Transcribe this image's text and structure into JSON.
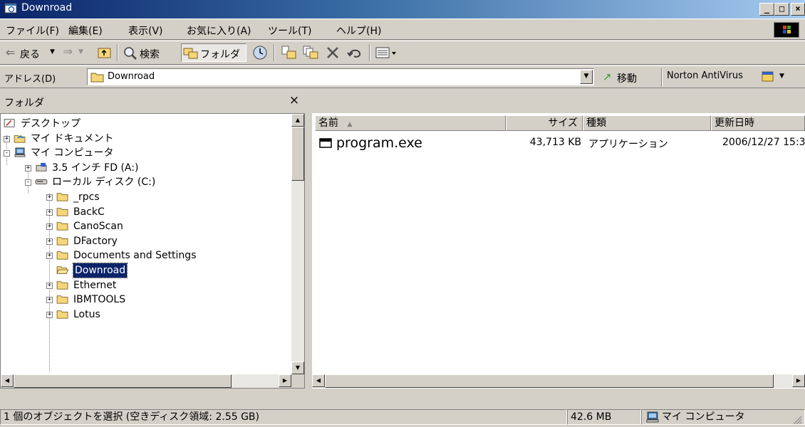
{
  "window": {
    "title": "Downroad"
  },
  "menu": [
    "ファイル(F)",
    "編集(E)",
    "表示(V)",
    "お気に入り(A)",
    "ツール(T)",
    "ヘルプ(H)"
  ],
  "toolbar": {
    "back_label": "戻る",
    "search_label": "検索",
    "folders_label": "フォルダ"
  },
  "address": {
    "label": "アドレス(D)",
    "value": "Downroad",
    "go_label": "移動",
    "norton_label": "Norton AntiVirus"
  },
  "folder_pane": {
    "title": "フォルダ",
    "close_glyph": "×",
    "items": [
      {
        "label": "デスクトップ",
        "expander": ""
      },
      {
        "label": "マイ ドキュメント",
        "expander": "+"
      },
      {
        "label": "マイ コンピュータ",
        "expander": "−"
      },
      {
        "label": "3.5 インチ FD (A:)",
        "expander": "+"
      },
      {
        "label": "ローカル ディスク (C:)",
        "expander": "−"
      },
      {
        "label": "_rpcs",
        "expander": "+"
      },
      {
        "label": "BackC",
        "expander": "+"
      },
      {
        "label": "CanoScan",
        "expander": "+"
      },
      {
        "label": "DFactory",
        "expander": "+"
      },
      {
        "label": "Documents and Settings",
        "expander": "+"
      },
      {
        "label": "Downroad",
        "expander": "",
        "selected": true
      },
      {
        "label": "Ethernet",
        "expander": "+"
      },
      {
        "label": "IBMTOOLS",
        "expander": "+"
      },
      {
        "label": "Lotus",
        "expander": "+"
      }
    ]
  },
  "list": {
    "columns": {
      "name": "名前",
      "size": "サイズ",
      "type": "種類",
      "modified": "更新日時"
    },
    "rows": [
      {
        "name": "program.exe",
        "size": "43,713 KB",
        "type": "アプリケーション",
        "modified": "2006/12/27 15:3"
      }
    ]
  },
  "status": {
    "selection": "1 個のオブジェクトを選択 (空きディスク領域: 2.55 GB)",
    "size": "42.6 MB",
    "location": "マイ コンピュータ"
  },
  "colors": {
    "title_start": "#0a246a",
    "title_end": "#a6caf0",
    "selection": "#0a246a",
    "folder": "#f5d67b"
  }
}
